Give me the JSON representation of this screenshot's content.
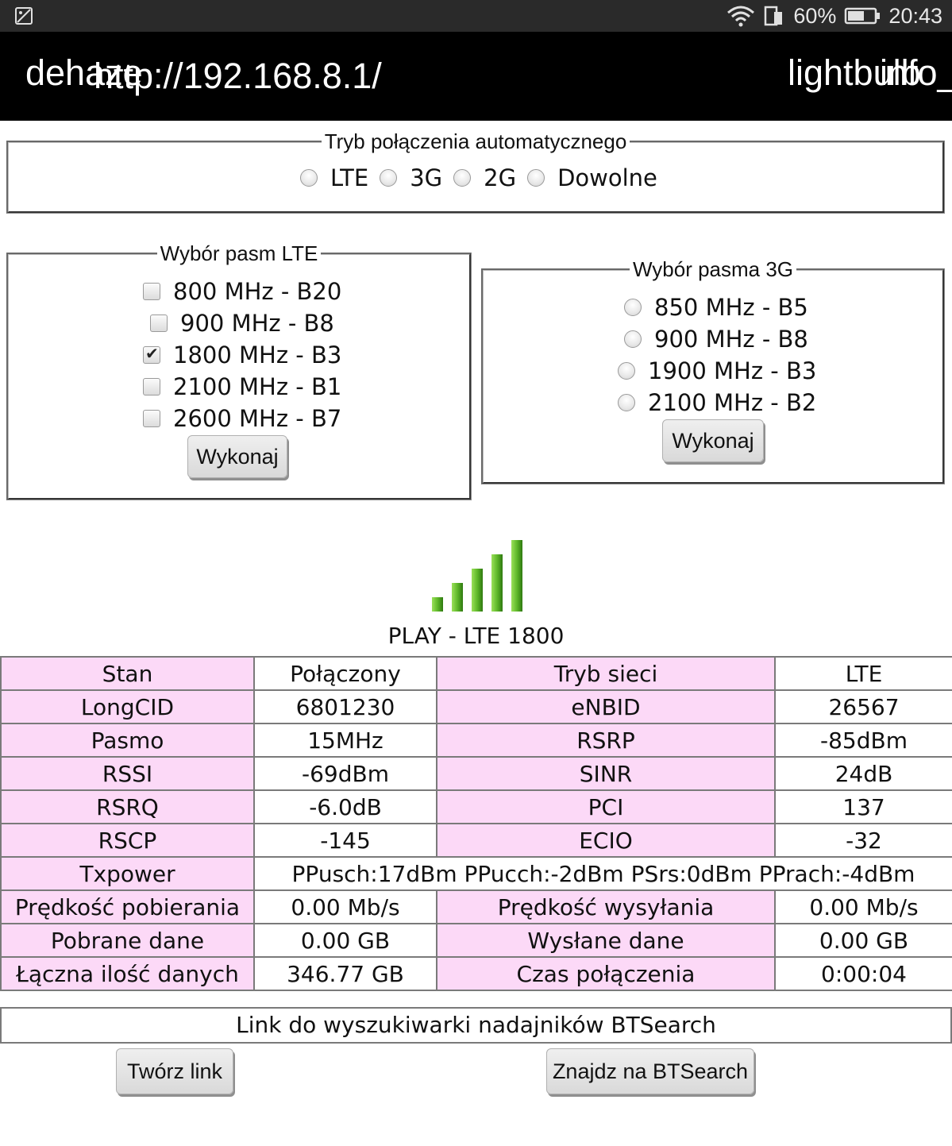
{
  "statusbar": {
    "battery": "60%",
    "time": "20:43"
  },
  "titlebar": {
    "left_text": "dehaze",
    "url": "http://192.168.8.1/",
    "right_text_1": "lightbulb",
    "right_text_2": "info_"
  },
  "auto_mode": {
    "legend": "Tryb połączenia automatycznego",
    "options": [
      "LTE",
      "3G",
      "2G",
      "Dowolne"
    ]
  },
  "lte_bands": {
    "legend": "Wybór pasm LTE",
    "items": [
      {
        "label": "800 MHz - B20",
        "checked": false
      },
      {
        "label": "900 MHz - B8",
        "checked": false
      },
      {
        "label": "1800 MHz - B3",
        "checked": true
      },
      {
        "label": "2100 MHz - B1",
        "checked": false
      },
      {
        "label": "2600 MHz - B7",
        "checked": false
      }
    ],
    "button": "Wykonaj"
  },
  "band_3g": {
    "legend": "Wybór pasma 3G",
    "items": [
      "850 MHz - B5",
      "900 MHz - B8",
      "1900 MHz - B3",
      "2100 MHz - B2"
    ],
    "button": "Wykonaj"
  },
  "operator": "PLAY - LTE 1800",
  "signal": {
    "bars": 5,
    "filled": 5,
    "colors": {
      "light": "#8fd14f",
      "dark": "#2f7a10"
    }
  },
  "table": {
    "rows": [
      [
        "Stan",
        "Połączony",
        "Tryb sieci",
        "LTE"
      ],
      [
        "LongCID",
        "6801230",
        "eNBID",
        "26567"
      ],
      [
        "Pasmo",
        "15MHz",
        "RSRP",
        "-85dBm"
      ],
      [
        "RSSI",
        "-69dBm",
        "SINR",
        "24dB"
      ],
      [
        "RSRQ",
        "-6.0dB",
        "PCI",
        "137"
      ],
      [
        "RSCP",
        "-145",
        "ECIO",
        "-32"
      ],
      [
        "Txpower",
        "PPusch:17dBm PPucch:-2dBm PSrs:0dBm PPrach:-4dBm"
      ],
      [
        "Prędkość pobierania",
        "0.00 Mb/s",
        "Prędkość wysyłania",
        "0.00 Mb/s"
      ],
      [
        "Pobrane dane",
        "0.00 GB",
        "Wysłane dane",
        "0.00 GB"
      ],
      [
        "Łączna ilość danych",
        "346.77 GB",
        "Czas połączenia",
        "0:00:04"
      ]
    ]
  },
  "bts_link": "Link do wyszukiwarki nadajników BTSearch",
  "buttons": {
    "create_link": "Twórz link",
    "find_bts": "Znajdz na BTSearch"
  }
}
